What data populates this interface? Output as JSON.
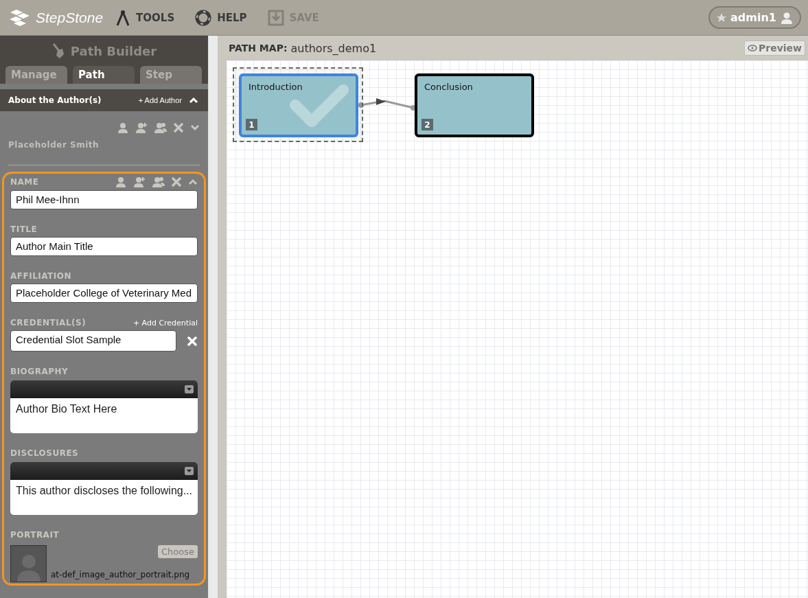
{
  "toolbar": {
    "logo": "StepStone",
    "items": [
      {
        "kind": "tools",
        "label": "TOOLS",
        "disabled": false
      },
      {
        "kind": "help",
        "label": "HELP",
        "disabled": false
      },
      {
        "kind": "save",
        "label": "SAVE",
        "disabled": true
      }
    ],
    "user": "admin1"
  },
  "sidebar": {
    "title": "Path Builder",
    "tabs": [
      {
        "label": "Manage",
        "selected": false
      },
      {
        "label": "Path",
        "selected": true
      },
      {
        "label": "Step",
        "selected": false
      }
    ],
    "section": {
      "title": "About the Author(s)",
      "add_label": "+ Add Author",
      "expanded": true
    },
    "authors": [
      {
        "name": "Placeholder Smith",
        "expanded": false,
        "selected": false
      },
      {
        "expanded": true,
        "selected": true,
        "fields": [
          {
            "kind": "text",
            "label": "NAME",
            "value": "Phil Mee-Ihnn"
          },
          {
            "kind": "text",
            "label": "TITLE",
            "value": "Author Main Title"
          },
          {
            "kind": "text",
            "label": "AFFILIATION",
            "value": "Placeholder College of Veterinary Med"
          },
          {
            "kind": "credential",
            "label": "CREDENTIAL(S)",
            "action": "+ Add Credential",
            "value": "Credential Slot Sample"
          },
          {
            "kind": "richtext",
            "label": "BIOGRAPHY",
            "value": "Author Bio Text Here"
          },
          {
            "kind": "richtext",
            "label": "DISCLOSURES",
            "value": "This author discloses the following..."
          },
          {
            "kind": "portrait",
            "label": "PORTRAIT",
            "button": "Choose",
            "filename": "at-def_image_author_portrait.png"
          }
        ]
      }
    ]
  },
  "path_map": {
    "label": "PATH MAP:",
    "name": "authors_demo1",
    "preview": "Preview",
    "nodes": [
      {
        "title": "Introduction",
        "number": "1",
        "selected": true,
        "completed": true
      },
      {
        "title": "Conclusion",
        "number": "2",
        "selected": false,
        "completed": false
      }
    ]
  }
}
